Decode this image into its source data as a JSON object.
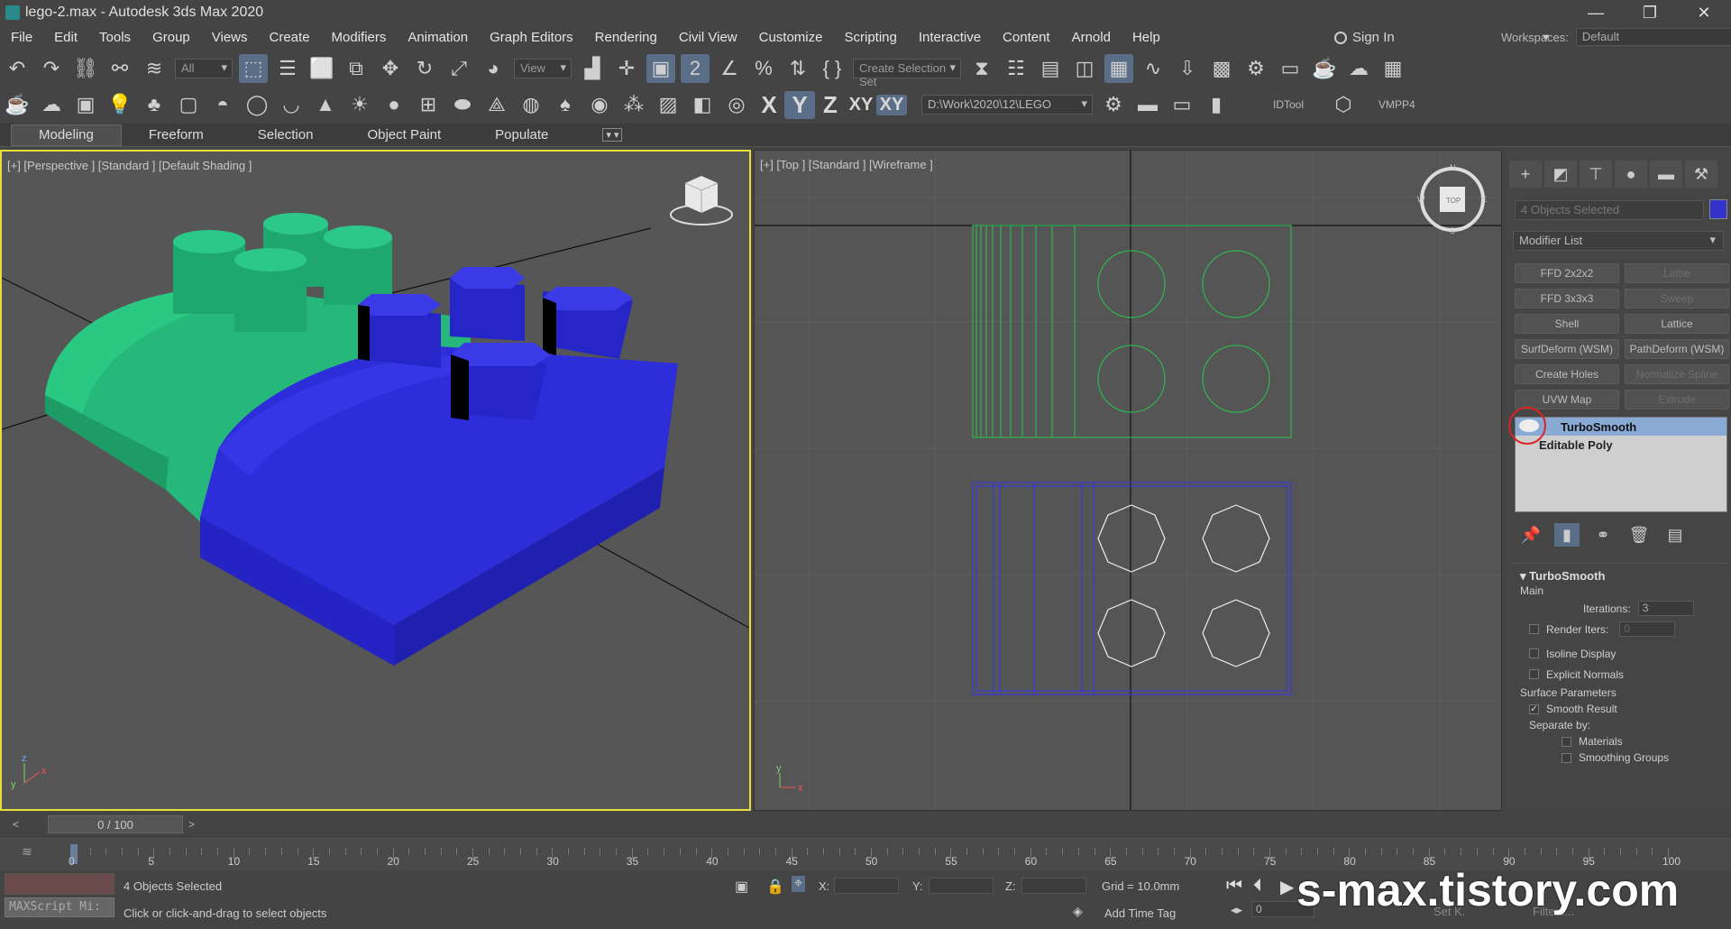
{
  "window": {
    "title": "lego-2.max - Autodesk 3ds Max 2020",
    "controls": [
      "—",
      "❐",
      "✕"
    ]
  },
  "menu": [
    "File",
    "Edit",
    "Tools",
    "Group",
    "Views",
    "Create",
    "Modifiers",
    "Animation",
    "Graph Editors",
    "Rendering",
    "Civil View",
    "Customize",
    "Scripting",
    "Interactive",
    "Content",
    "Arnold",
    "Help"
  ],
  "account": {
    "sign_in": "Sign In",
    "workspaces_label": "Workspaces:",
    "workspace": "Default"
  },
  "toolbar": {
    "filter": "All",
    "ref_coord": "View",
    "selection_set": "Create Selection Set",
    "project_path": "D:\\Work\\2020\\12\\LEGO",
    "idtool": "IDTool",
    "vmpp4": "VMPP4",
    "axes": [
      "X",
      "Y",
      "Z",
      "XY",
      "XY"
    ]
  },
  "ribbon_tabs": [
    "Modeling",
    "Freeform",
    "Selection",
    "Object Paint",
    "Populate"
  ],
  "viewport_left": {
    "label": "[+] [Perspective ] [Standard ] [Default Shading ]"
  },
  "viewport_right": {
    "label": "[+] [Top ] [Standard ] [Wireframe ]",
    "viewcube": "TOP",
    "compass": [
      "N",
      "E",
      "S",
      "W"
    ]
  },
  "command_panel": {
    "selection": "4 Objects Selected",
    "object_color": "#3333cc",
    "modifier_list": "Modifier List",
    "buttons": [
      {
        "label": "FFD 2x2x2",
        "enabled": true
      },
      {
        "label": "Lathe",
        "enabled": false
      },
      {
        "label": "FFD 3x3x3",
        "enabled": true
      },
      {
        "label": "Sweep",
        "enabled": false
      },
      {
        "label": "Shell",
        "enabled": true
      },
      {
        "label": "Lattice",
        "enabled": true
      },
      {
        "label": "SurfDeform (WSM)",
        "enabled": true
      },
      {
        "label": "PathDeform (WSM)",
        "enabled": true
      },
      {
        "label": "Create Holes",
        "enabled": true
      },
      {
        "label": "Normalize Spline",
        "enabled": false
      },
      {
        "label": "UVW Map",
        "enabled": true
      },
      {
        "label": "Extrude",
        "enabled": false
      }
    ],
    "stack": {
      "modifier": "TurboSmooth",
      "base": "Editable Poly"
    },
    "rollout": {
      "title": "TurboSmooth",
      "main": "Main",
      "iterations_label": "Iterations:",
      "iterations": "3",
      "render_iters_label": "Render Iters:",
      "render_iters": "0",
      "isoline": "Isoline Display",
      "explicit": "Explicit Normals",
      "surface_params": "Surface Parameters",
      "smooth_result": "Smooth Result",
      "separate_by": "Separate by:",
      "materials": "Materials",
      "smoothing_groups": "Smoothing Groups"
    }
  },
  "timeline": {
    "position": "0 / 100",
    "ticks": [
      "0",
      "5",
      "10",
      "15",
      "20",
      "25",
      "30",
      "35",
      "40",
      "45",
      "50",
      "55",
      "60",
      "65",
      "70",
      "75",
      "80",
      "85",
      "90",
      "95",
      "100"
    ]
  },
  "status": {
    "selected": "4 Objects Selected",
    "prompt": "Click or click-and-drag to select objects",
    "maxscript": "MAXScript Mi:",
    "x_label": "X:",
    "y_label": "Y:",
    "z_label": "Z:",
    "grid": "Grid = 10.0mm",
    "add_time_tag": "Add Time Tag",
    "frame": "0",
    "set_k": "Set K.",
    "filters": "Filters..."
  },
  "watermark": "s-max.tistory.com"
}
